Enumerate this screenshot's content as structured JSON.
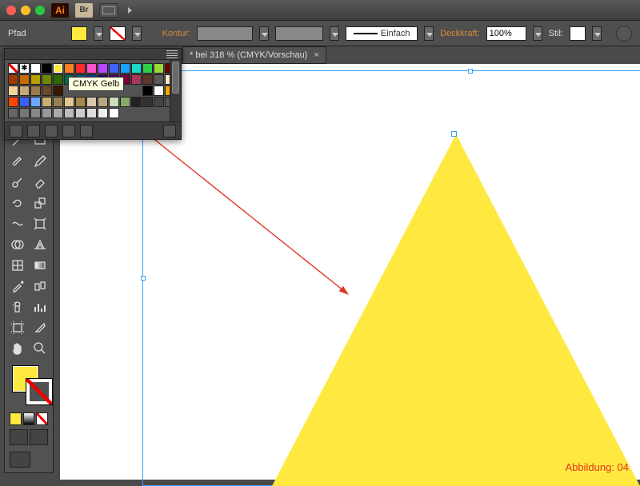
{
  "window": {
    "app_abbrev": "Ai",
    "bridge_abbrev": "Br"
  },
  "controlbar": {
    "object_type": "Pfad",
    "stroke_label": "Kontur:",
    "stroke_style_label": "Einfach",
    "opacity_label": "Deckkraft:",
    "opacity_value": "100%",
    "style_label": "Stil:"
  },
  "document_tab": {
    "title": "* bei 318 % (CMYK/Vorschau)"
  },
  "swatches_panel": {
    "tooltip_text": "CMYK Gelb",
    "row1_colors": [
      "nstroke",
      "reg",
      "#ffffff",
      "#000000",
      "#ffe940",
      "#ff7f27",
      "#ff2a2a",
      "#ff52c8",
      "#b648ff",
      "#4060ff",
      "#1aa0ff",
      "#18d8c8",
      "#2fd04a",
      "#9bd93a"
    ],
    "row2_colors": [
      "#6e0000",
      "#a03a00",
      "#c86a00",
      "#b8a000",
      "#6a8a00",
      "#2f6a00",
      "#006a4a",
      "#005a7a",
      "#003a9a",
      "#2a007a",
      "#5a006a",
      "#7a003a",
      "#a83858",
      "#5a3828"
    ],
    "row3_colors": [
      "#5a5a5a",
      "#ffeacc",
      "#f6d49a",
      "#c8a878",
      "#9a7a4a",
      "#6a4a2a",
      "#381800"
    ],
    "row4_colors": [
      "#000000",
      "#ffffff",
      "#ffa800",
      "#ff4800",
      "#3a60ff",
      "#6aa8ff",
      "#c8b070",
      "#9a8050",
      "#e0c890",
      "#a88848",
      "#d8c8a8",
      "#b8a880",
      "#ccddb8",
      "#88aa68"
    ],
    "row5_colors": [
      "#222",
      "#333",
      "#444",
      "#555",
      "#666",
      "#777",
      "#888",
      "#999",
      "#aaa",
      "#bbb",
      "#ccc",
      "#ddd",
      "#eee",
      "#fff"
    ],
    "selected_index": 4
  },
  "canvas": {
    "triangle_fill": "#ffe940"
  },
  "figure_label": "Abbildung: 04"
}
